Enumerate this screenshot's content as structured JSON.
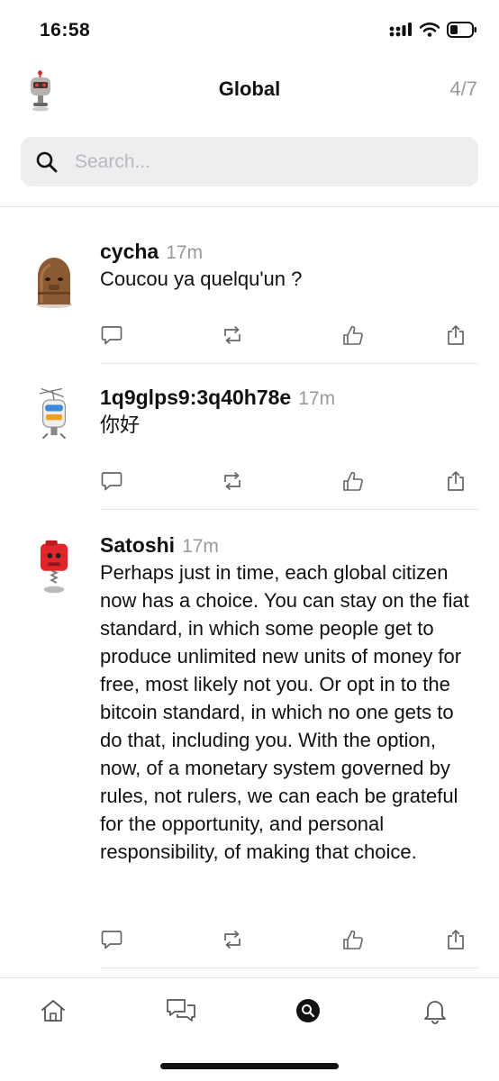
{
  "status_bar": {
    "time": "16:58"
  },
  "header": {
    "title": "Global",
    "count": "4/7"
  },
  "search": {
    "placeholder": "Search..."
  },
  "posts": [
    {
      "name": "cycha",
      "time": "17m",
      "text": "Coucou ya quelqu'un ?"
    },
    {
      "name": "1q9glps9:3q40h78e",
      "time": "17m",
      "text": "你好"
    },
    {
      "name": "Satoshi",
      "time": "17m",
      "text": "Perhaps just in time, each global citizen now has a choice. You can stay on the fiat standard, in which some people get to produce unlimited new units of money for free, most likely not you. Or opt in to the bitcoin standard, in which no one gets to do that, including you. With the option, now, of a monetary system governed by rules, not rulers, we can each be grateful for the opportunity, and personal responsibility, of making that choice."
    }
  ],
  "post_actions": [
    "reply-icon",
    "repost-icon",
    "like-icon",
    "share-icon"
  ],
  "tabs": [
    "home-icon",
    "messages-icon",
    "search-icon",
    "notifications-icon"
  ],
  "colors": {
    "muted": "#9a9a9a",
    "search_bg": "#eeeef0",
    "divider": "#e6e6e6",
    "avatar_red": "#e0262b",
    "avatar_brown": "#8a5a32"
  }
}
